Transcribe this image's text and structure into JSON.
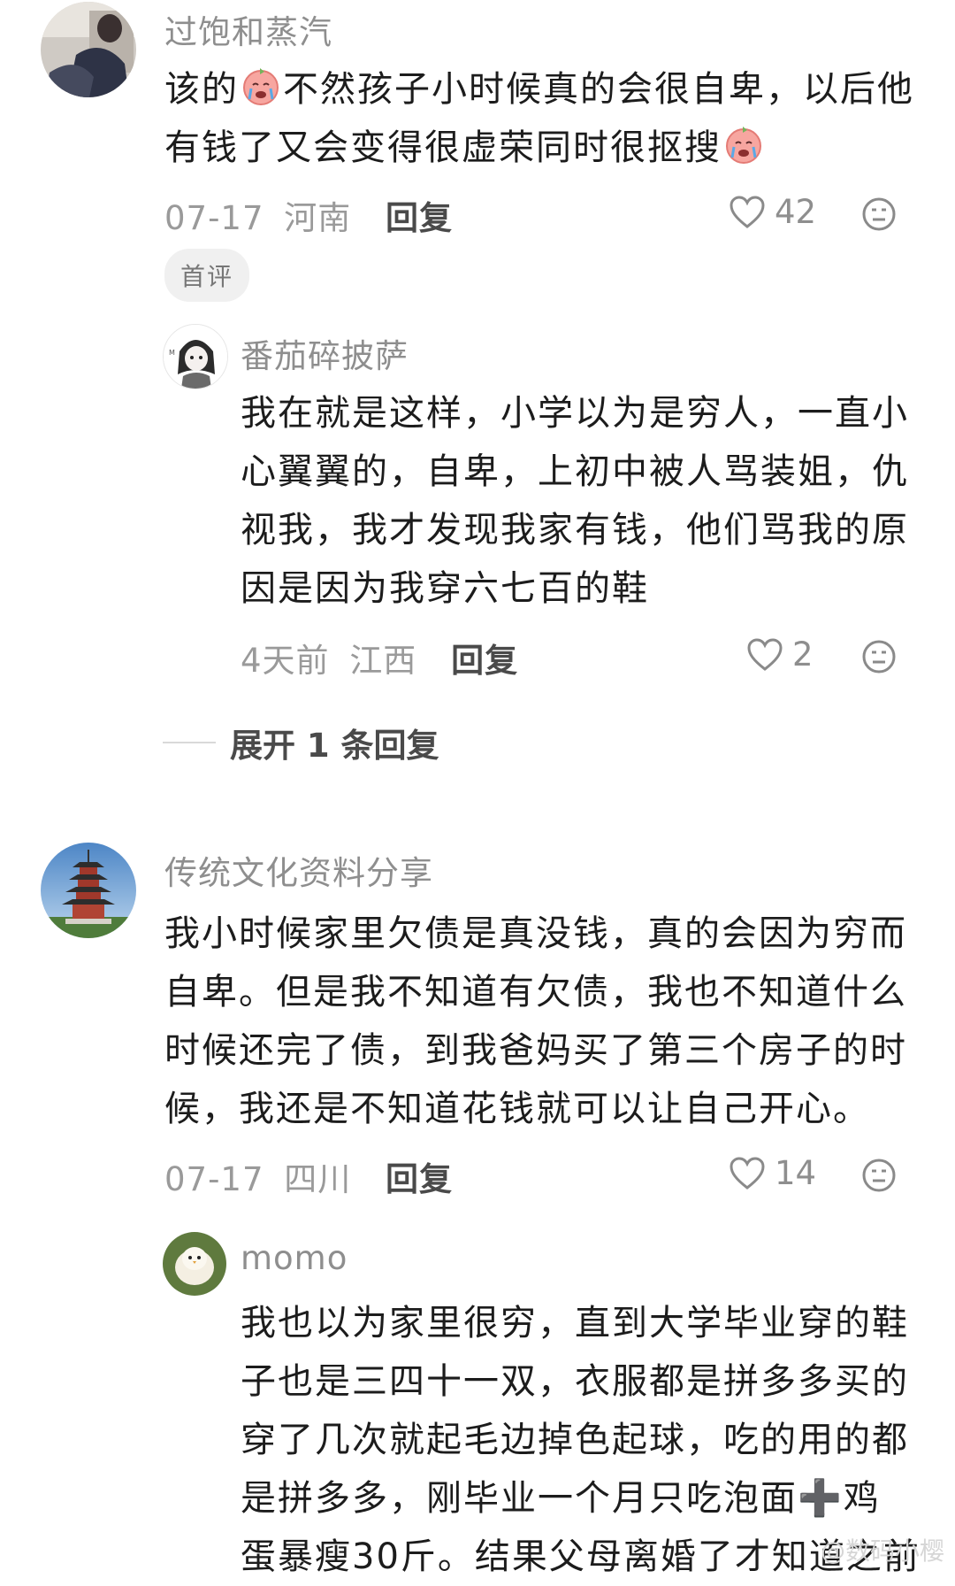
{
  "comments": [
    {
      "username": "过饱和蒸汽",
      "content_lines": [
        "该的",
        "不然孩子小时候真的会很自卑，以后他",
        "有钱了又会变得很虚荣同时很抠搜"
      ],
      "date": "07-17",
      "location": "河南",
      "reply_label": "回复",
      "likes": "42",
      "tag": "首评",
      "avatar_icon": "person-photo-avatar",
      "reply": {
        "username": "番茄碎披萨",
        "content_lines": [
          "我在就是这样，小学以为是穷人，一直小",
          "心翼翼的，自卑，上初中被人骂装姐，仇",
          "视我，我才发现我家有钱，他们骂我的原",
          "因是因为我穿六七百的鞋"
        ],
        "date": "4天前",
        "location": "江西",
        "reply_label": "回复",
        "likes": "2",
        "avatar_icon": "anime-girl-avatar"
      },
      "expand_label": "展开 1 条回复"
    },
    {
      "username": "传统文化资料分享",
      "content_lines": [
        "我小时候家里欠债是真没钱，真的会因为穷而",
        "自卑。但是我不知道有欠债，我也不知道什么",
        "时候还完了债，到我爸妈买了第三个房子的时",
        "候，我还是不知道花钱就可以让自己开心。"
      ],
      "date": "07-17",
      "location": "四川",
      "reply_label": "回复",
      "likes": "14",
      "avatar_icon": "pagoda-avatar",
      "reply": {
        "username": "momo",
        "content_lines": [
          "我也以为家里很穷，直到大学毕业穿的鞋",
          "子也是三四十一双，衣服都是拼多多买的",
          "穿了几次就起毛边掉色起球，吃的用的都",
          "是拼多多，刚毕业一个月只吃泡面➕鸡",
          "蛋暴瘦30斤。结果父母离婚了才知道之前"
        ],
        "avatar_icon": "fluffy-chick-avatar"
      }
    }
  ],
  "watermark": "@数码小樱",
  "colors": {
    "username": "#8e8e8e",
    "content": "#1c1c1c",
    "meta": "#9a9a9a",
    "reply_button": "#4a4a4a",
    "tag_bg": "#f0f0f0"
  }
}
